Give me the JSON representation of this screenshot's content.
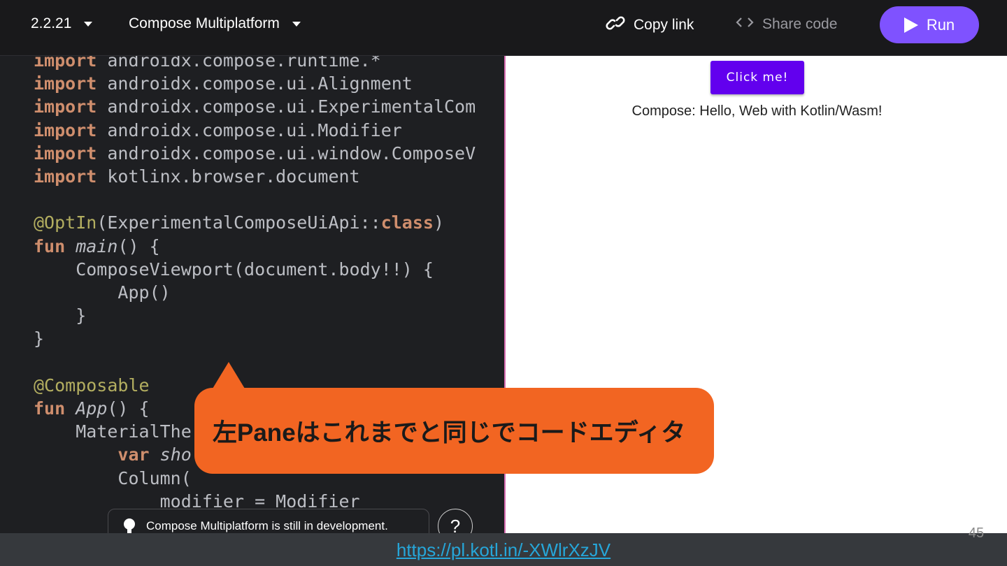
{
  "toolbar": {
    "version": "2.2.21",
    "platform": "Compose Multiplatform",
    "copy_link": "Copy link",
    "share_code": "Share code",
    "run": "Run"
  },
  "code_lines": [
    [
      {
        "t": "import",
        "c": "kw"
      },
      {
        "t": " androidx.compose.runtime.*"
      }
    ],
    [
      {
        "t": "import",
        "c": "kw"
      },
      {
        "t": " androidx.compose.ui.Alignment"
      }
    ],
    [
      {
        "t": "import",
        "c": "kw"
      },
      {
        "t": " androidx.compose.ui.ExperimentalCom"
      }
    ],
    [
      {
        "t": "import",
        "c": "kw"
      },
      {
        "t": " androidx.compose.ui.Modifier"
      }
    ],
    [
      {
        "t": "import",
        "c": "kw"
      },
      {
        "t": " androidx.compose.ui.window.ComposeV"
      }
    ],
    [
      {
        "t": "import",
        "c": "kw"
      },
      {
        "t": " kotlinx.browser.document"
      }
    ],
    [],
    [
      {
        "t": "@OptIn",
        "c": "ann"
      },
      {
        "t": "(ExperimentalComposeUiApi::"
      },
      {
        "t": "class",
        "c": "kw"
      },
      {
        "t": ")"
      }
    ],
    [
      {
        "t": "fun",
        "c": "kw"
      },
      {
        "t": " "
      },
      {
        "t": "main",
        "c": "fn"
      },
      {
        "t": "() {"
      }
    ],
    [
      {
        "t": "    ComposeViewport(document.body!!) {"
      }
    ],
    [
      {
        "t": "        App()"
      }
    ],
    [
      {
        "t": "    }"
      }
    ],
    [
      {
        "t": "}"
      }
    ],
    [],
    [
      {
        "t": "@Composable",
        "c": "ann"
      }
    ],
    [
      {
        "t": "fun",
        "c": "kw"
      },
      {
        "t": " "
      },
      {
        "t": "App",
        "c": "fn"
      },
      {
        "t": "() {"
      }
    ],
    [
      {
        "t": "    MaterialThe"
      }
    ],
    [
      {
        "t": "        "
      },
      {
        "t": "var",
        "c": "kw"
      },
      {
        "t": " "
      },
      {
        "t": "sho",
        "c": "fn"
      }
    ],
    [
      {
        "t": "        Column("
      }
    ],
    [
      {
        "t": "            modifier = Modifier"
      }
    ]
  ],
  "preview": {
    "button_label": "Click me!",
    "greeting": "Compose: Hello, Web with Kotlin/Wasm!"
  },
  "callout": "左Paneはこれまでと同じでコードエディタ",
  "notice": "Compose Multiplatform is still in development.",
  "help": "?",
  "footer": {
    "url": "https://pl.kotl.in/-XWlrXzJV",
    "page": "45"
  }
}
